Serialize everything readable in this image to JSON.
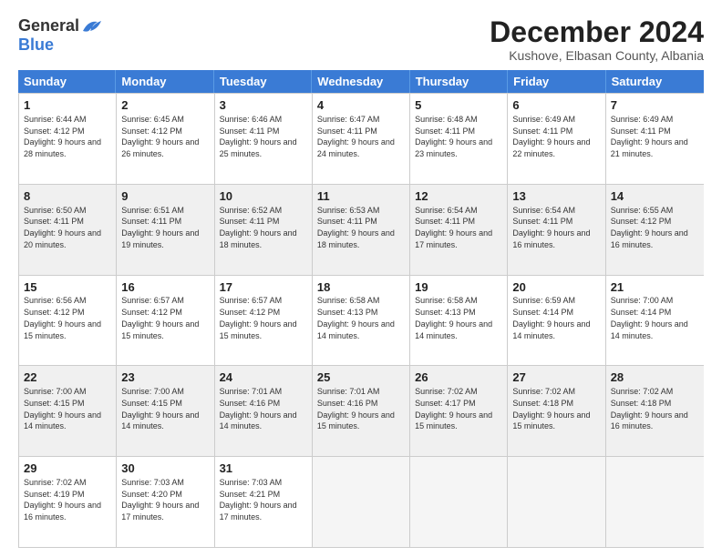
{
  "logo": {
    "general": "General",
    "blue": "Blue"
  },
  "title": "December 2024",
  "location": "Kushove, Elbasan County, Albania",
  "days_of_week": [
    "Sunday",
    "Monday",
    "Tuesday",
    "Wednesday",
    "Thursday",
    "Friday",
    "Saturday"
  ],
  "weeks": [
    [
      {
        "day": "1",
        "info": "Sunrise: 6:44 AM\nSunset: 4:12 PM\nDaylight: 9 hours and 28 minutes."
      },
      {
        "day": "2",
        "info": "Sunrise: 6:45 AM\nSunset: 4:12 PM\nDaylight: 9 hours and 26 minutes."
      },
      {
        "day": "3",
        "info": "Sunrise: 6:46 AM\nSunset: 4:11 PM\nDaylight: 9 hours and 25 minutes."
      },
      {
        "day": "4",
        "info": "Sunrise: 6:47 AM\nSunset: 4:11 PM\nDaylight: 9 hours and 24 minutes."
      },
      {
        "day": "5",
        "info": "Sunrise: 6:48 AM\nSunset: 4:11 PM\nDaylight: 9 hours and 23 minutes."
      },
      {
        "day": "6",
        "info": "Sunrise: 6:49 AM\nSunset: 4:11 PM\nDaylight: 9 hours and 22 minutes."
      },
      {
        "day": "7",
        "info": "Sunrise: 6:49 AM\nSunset: 4:11 PM\nDaylight: 9 hours and 21 minutes."
      }
    ],
    [
      {
        "day": "8",
        "info": "Sunrise: 6:50 AM\nSunset: 4:11 PM\nDaylight: 9 hours and 20 minutes."
      },
      {
        "day": "9",
        "info": "Sunrise: 6:51 AM\nSunset: 4:11 PM\nDaylight: 9 hours and 19 minutes."
      },
      {
        "day": "10",
        "info": "Sunrise: 6:52 AM\nSunset: 4:11 PM\nDaylight: 9 hours and 18 minutes."
      },
      {
        "day": "11",
        "info": "Sunrise: 6:53 AM\nSunset: 4:11 PM\nDaylight: 9 hours and 18 minutes."
      },
      {
        "day": "12",
        "info": "Sunrise: 6:54 AM\nSunset: 4:11 PM\nDaylight: 9 hours and 17 minutes."
      },
      {
        "day": "13",
        "info": "Sunrise: 6:54 AM\nSunset: 4:11 PM\nDaylight: 9 hours and 16 minutes."
      },
      {
        "day": "14",
        "info": "Sunrise: 6:55 AM\nSunset: 4:12 PM\nDaylight: 9 hours and 16 minutes."
      }
    ],
    [
      {
        "day": "15",
        "info": "Sunrise: 6:56 AM\nSunset: 4:12 PM\nDaylight: 9 hours and 15 minutes."
      },
      {
        "day": "16",
        "info": "Sunrise: 6:57 AM\nSunset: 4:12 PM\nDaylight: 9 hours and 15 minutes."
      },
      {
        "day": "17",
        "info": "Sunrise: 6:57 AM\nSunset: 4:12 PM\nDaylight: 9 hours and 15 minutes."
      },
      {
        "day": "18",
        "info": "Sunrise: 6:58 AM\nSunset: 4:13 PM\nDaylight: 9 hours and 14 minutes."
      },
      {
        "day": "19",
        "info": "Sunrise: 6:58 AM\nSunset: 4:13 PM\nDaylight: 9 hours and 14 minutes."
      },
      {
        "day": "20",
        "info": "Sunrise: 6:59 AM\nSunset: 4:14 PM\nDaylight: 9 hours and 14 minutes."
      },
      {
        "day": "21",
        "info": "Sunrise: 7:00 AM\nSunset: 4:14 PM\nDaylight: 9 hours and 14 minutes."
      }
    ],
    [
      {
        "day": "22",
        "info": "Sunrise: 7:00 AM\nSunset: 4:15 PM\nDaylight: 9 hours and 14 minutes."
      },
      {
        "day": "23",
        "info": "Sunrise: 7:00 AM\nSunset: 4:15 PM\nDaylight: 9 hours and 14 minutes."
      },
      {
        "day": "24",
        "info": "Sunrise: 7:01 AM\nSunset: 4:16 PM\nDaylight: 9 hours and 14 minutes."
      },
      {
        "day": "25",
        "info": "Sunrise: 7:01 AM\nSunset: 4:16 PM\nDaylight: 9 hours and 15 minutes."
      },
      {
        "day": "26",
        "info": "Sunrise: 7:02 AM\nSunset: 4:17 PM\nDaylight: 9 hours and 15 minutes."
      },
      {
        "day": "27",
        "info": "Sunrise: 7:02 AM\nSunset: 4:18 PM\nDaylight: 9 hours and 15 minutes."
      },
      {
        "day": "28",
        "info": "Sunrise: 7:02 AM\nSunset: 4:18 PM\nDaylight: 9 hours and 16 minutes."
      }
    ],
    [
      {
        "day": "29",
        "info": "Sunrise: 7:02 AM\nSunset: 4:19 PM\nDaylight: 9 hours and 16 minutes."
      },
      {
        "day": "30",
        "info": "Sunrise: 7:03 AM\nSunset: 4:20 PM\nDaylight: 9 hours and 17 minutes."
      },
      {
        "day": "31",
        "info": "Sunrise: 7:03 AM\nSunset: 4:21 PM\nDaylight: 9 hours and 17 minutes."
      },
      {
        "day": "",
        "info": ""
      },
      {
        "day": "",
        "info": ""
      },
      {
        "day": "",
        "info": ""
      },
      {
        "day": "",
        "info": ""
      }
    ]
  ]
}
